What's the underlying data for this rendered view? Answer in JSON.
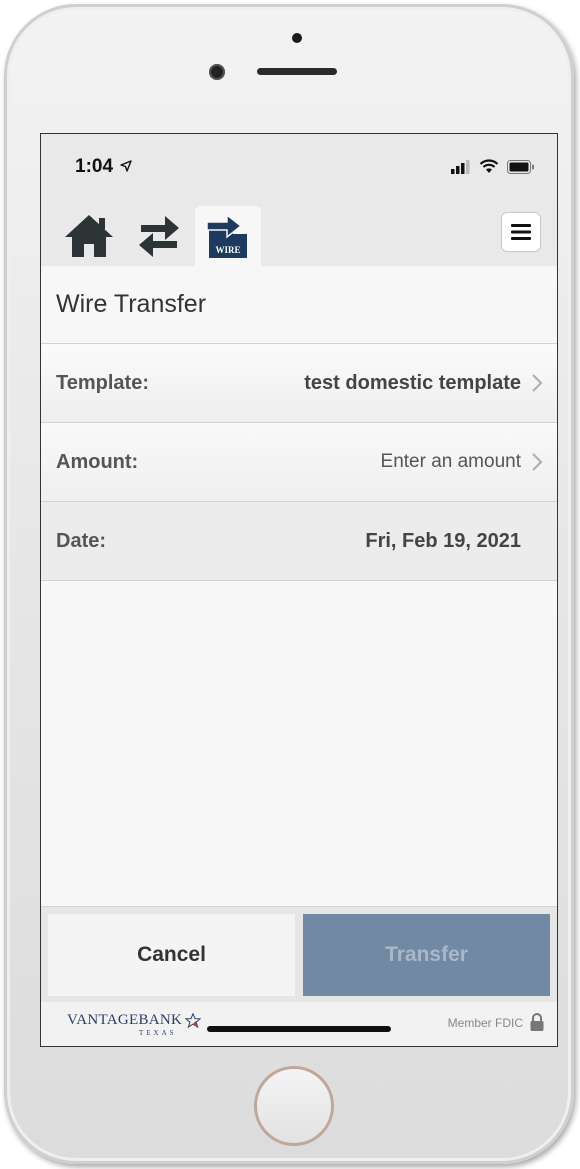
{
  "status_bar": {
    "time": "1:04"
  },
  "nav": {
    "wire_icon_text": "WIRE"
  },
  "page": {
    "title": "Wire Transfer"
  },
  "form": {
    "template": {
      "label": "Template:",
      "value": "test domestic template"
    },
    "amount": {
      "label": "Amount:",
      "placeholder": "Enter an amount"
    },
    "date": {
      "label": "Date:",
      "value": "Fri, Feb 19, 2021"
    }
  },
  "actions": {
    "cancel_label": "Cancel",
    "transfer_label": "Transfer"
  },
  "footer": {
    "brand": "VANTAGEBANK",
    "brand_sub": "TEXAS",
    "fdic": "Member FDIC"
  },
  "colors": {
    "brand_navy": "#1f3a5f",
    "transfer_disabled": "#7189a2",
    "icon_dark": "#2d3436"
  }
}
